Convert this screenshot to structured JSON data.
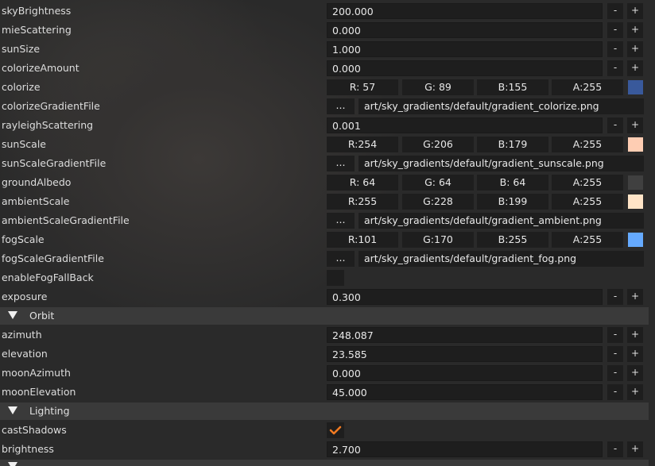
{
  "rows": {
    "skyBrightness": {
      "label": "skyBrightness",
      "value": "200.000"
    },
    "mieScattering": {
      "label": "mieScattering",
      "value": "0.000"
    },
    "sunSize": {
      "label": "sunSize",
      "value": "1.000"
    },
    "colorizeAmount": {
      "label": "colorizeAmount",
      "value": "0.000"
    },
    "colorize": {
      "label": "colorize",
      "r": "R: 57",
      "g": "G: 89",
      "b": "B:155",
      "a": "A:255",
      "swatch": "#39599b"
    },
    "colorizeGradientFile": {
      "label": "colorizeGradientFile",
      "path": "art/sky_gradients/default/gradient_colorize.png"
    },
    "rayleighScattering": {
      "label": "rayleighScattering",
      "value": "0.001"
    },
    "sunScale": {
      "label": "sunScale",
      "r": "R:254",
      "g": "G:206",
      "b": "B:179",
      "a": "A:255",
      "swatch": "#fecdb3"
    },
    "sunScaleGradientFile": {
      "label": "sunScaleGradientFile",
      "path": "art/sky_gradients/default/gradient_sunscale.png"
    },
    "groundAlbedo": {
      "label": "groundAlbedo",
      "r": "R: 64",
      "g": "G: 64",
      "b": "B: 64",
      "a": "A:255",
      "swatch": "#404040"
    },
    "ambientScale": {
      "label": "ambientScale",
      "r": "R:255",
      "g": "G:228",
      "b": "B:199",
      "a": "A:255",
      "swatch": "#ffe4c7"
    },
    "ambientScaleGradientFile": {
      "label": "ambientScaleGradientFile",
      "path": "art/sky_gradients/default/gradient_ambient.png"
    },
    "fogScale": {
      "label": "fogScale",
      "r": "R:101",
      "g": "G:170",
      "b": "B:255",
      "a": "A:255",
      "swatch": "#65aaff"
    },
    "fogScaleGradientFile": {
      "label": "fogScaleGradientFile",
      "path": "art/sky_gradients/default/gradient_fog.png"
    },
    "enableFogFallBack": {
      "label": "enableFogFallBack"
    },
    "exposure": {
      "label": "exposure",
      "value": "0.300"
    },
    "azimuth": {
      "label": "azimuth",
      "value": "248.087"
    },
    "elevation": {
      "label": "elevation",
      "value": "23.585"
    },
    "moonAzimuth": {
      "label": "moonAzimuth",
      "value": "0.000"
    },
    "moonElevation": {
      "label": "moonElevation",
      "value": "45.000"
    },
    "castShadows": {
      "label": "castShadows",
      "checked": true
    },
    "brightness": {
      "label": "brightness",
      "value": "2.700"
    }
  },
  "sections": {
    "orbit": "Orbit",
    "lighting": "Lighting"
  },
  "buttons": {
    "minus": "-",
    "plus": "+",
    "browse": "..."
  },
  "colors": {
    "accent_check": "#f07a22",
    "section_bg": "#3a3a3a",
    "field_bg": "#1e1e1e"
  }
}
